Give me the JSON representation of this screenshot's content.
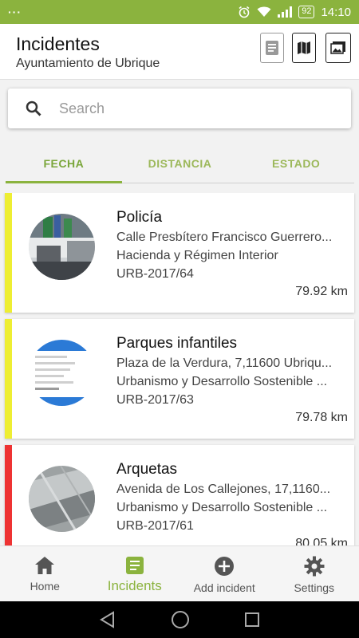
{
  "statusbar": {
    "dots": "···",
    "battery": "92",
    "time": "14:10"
  },
  "header": {
    "title": "Incidentes",
    "subtitle": "Ayuntamiento de Ubrique"
  },
  "search": {
    "placeholder": "Search",
    "value": ""
  },
  "tabs": [
    {
      "label": "FECHA",
      "active": true
    },
    {
      "label": "DISTANCIA",
      "active": false
    },
    {
      "label": "ESTADO",
      "active": false
    }
  ],
  "incidents": [
    {
      "title": "Policía",
      "address": "Calle Presbítero Francisco Guerrero...",
      "department": "Hacienda y Régimen Interior",
      "code": "URB-2017/64",
      "distance": "79.92 km",
      "status_color": "#eeee33"
    },
    {
      "title": "Parques infantiles",
      "address": "Plaza de la Verdura, 7,11600 Ubriqu...",
      "department": "Urbanismo y Desarrollo Sostenible ...",
      "code": "URB-2017/63",
      "distance": "79.78 km",
      "status_color": "#eeee33"
    },
    {
      "title": "Arquetas",
      "address": "Avenida de Los Callejones, 17,1160...",
      "department": "Urbanismo y Desarrollo Sostenible ...",
      "code": "URB-2017/61",
      "distance": "80.05 km",
      "status_color": "#ee3333"
    }
  ],
  "bottomnav": {
    "home": "Home",
    "incidents": "Incidents",
    "add": "Add incident",
    "settings": "Settings"
  },
  "colors": {
    "accent": "#8bb33e",
    "status_yellow": "#eeee33",
    "status_red": "#ee3333"
  },
  "icons": [
    "wifi-icon",
    "signal-icon",
    "alarm-icon",
    "list-view-icon",
    "map-icon",
    "gallery-icon",
    "search-icon",
    "home-icon",
    "incidents-icon",
    "add-circle-icon",
    "settings-icon",
    "back-icon",
    "home-circle-icon",
    "recents-icon"
  ]
}
